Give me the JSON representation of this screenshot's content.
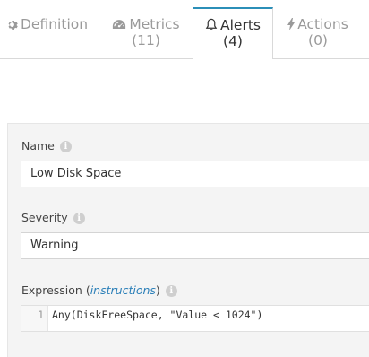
{
  "tabs": [
    {
      "label": "Definition",
      "icon": "gear-icon"
    },
    {
      "label": "Metrics",
      "count": "(11)",
      "icon": "dashboard-icon"
    },
    {
      "label": "Alerts",
      "count": "(4)",
      "icon": "bell-icon",
      "active": true
    },
    {
      "label": "Actions",
      "count": "(0)",
      "icon": "bolt-icon"
    }
  ],
  "form": {
    "name_label": "Name",
    "name_value": "Low Disk Space",
    "severity_label": "Severity",
    "severity_value": "Warning",
    "expression_label": "Expression (",
    "expression_link": "instructions",
    "expression_label_end": ")",
    "expression_line_number": "1",
    "expression_code": "Any(DiskFreeSpace, \"Value < 1024\")"
  },
  "colors": {
    "accent": "#2b8fb8",
    "panel_bg": "#f4f4f4"
  }
}
